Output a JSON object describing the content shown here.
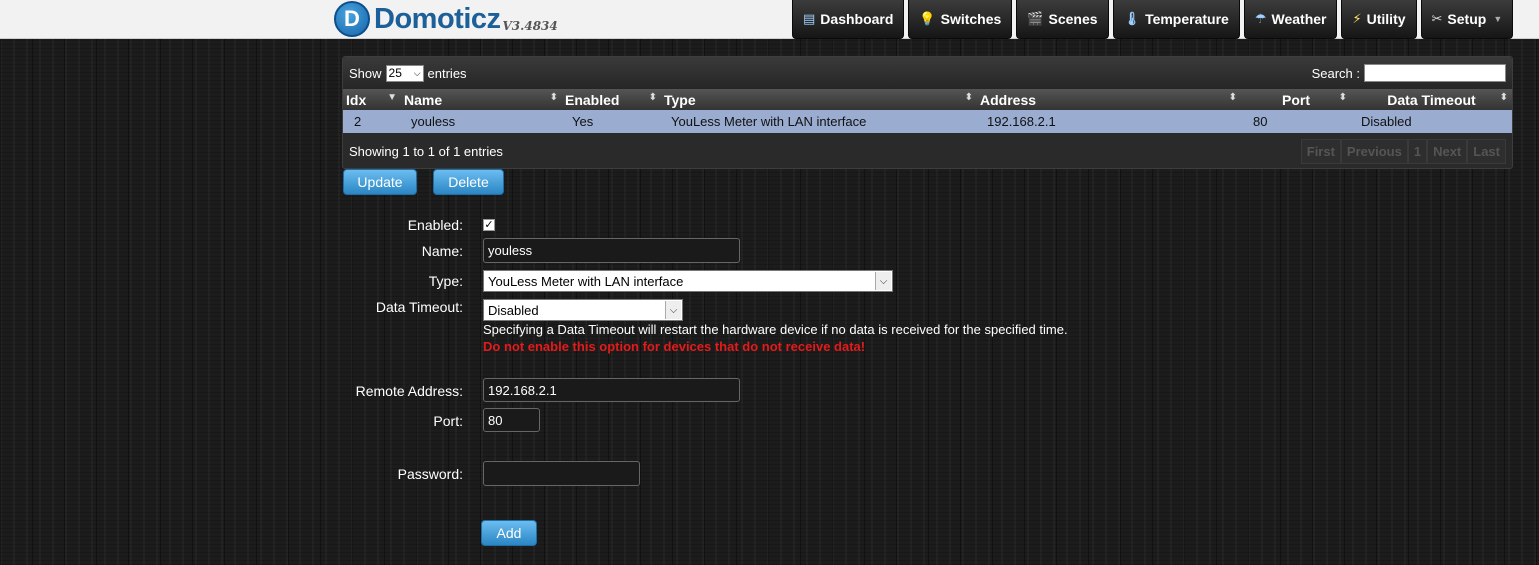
{
  "header": {
    "logo_mark": "D",
    "logo_text": "Domoticz",
    "version": "V3.4834",
    "nav": [
      {
        "label": "Dashboard",
        "icon": "dashboard-icon",
        "glyph": "▤"
      },
      {
        "label": "Switches",
        "icon": "lightbulb-icon",
        "glyph": "💡"
      },
      {
        "label": "Scenes",
        "icon": "clapperboard-icon",
        "glyph": "🎬"
      },
      {
        "label": "Temperature",
        "icon": "thermometer-icon",
        "glyph": "🌡"
      },
      {
        "label": "Weather",
        "icon": "cloud-rain-icon",
        "glyph": "☂"
      },
      {
        "label": "Utility",
        "icon": "lightning-icon",
        "glyph": "⚡"
      },
      {
        "label": "Setup",
        "icon": "tools-icon",
        "glyph": "✂"
      }
    ]
  },
  "table": {
    "show_label": "Show",
    "entries_value": "25",
    "entries_label": "entries",
    "search_label": "Search :",
    "search_value": "",
    "columns": [
      "Idx",
      "Name",
      "Enabled",
      "Type",
      "Address",
      "Port",
      "Data Timeout"
    ],
    "rows": [
      {
        "idx": "2",
        "name": "youless",
        "enabled": "Yes",
        "type": "YouLess Meter with LAN interface",
        "address": "192.168.2.1",
        "port": "80",
        "timeout": "Disabled"
      }
    ],
    "info": "Showing 1 to 1 of 1 entries",
    "paging": [
      "First",
      "Previous",
      "1",
      "Next",
      "Last"
    ]
  },
  "actions": {
    "update": "Update",
    "delete": "Delete"
  },
  "form": {
    "enabled_label": "Enabled:",
    "enabled_checked": true,
    "name_label": "Name:",
    "name_value": "youless",
    "type_label": "Type:",
    "type_value": "YouLess Meter with LAN interface",
    "timeout_label": "Data Timeout:",
    "timeout_value": "Disabled",
    "timeout_note": "Specifying a Data Timeout will restart the hardware device if no data is received for the specified time.",
    "timeout_warning": "Do not enable this option for devices that do not receive data!",
    "address_label": "Remote Address:",
    "address_value": "192.168.2.1",
    "port_label": "Port:",
    "port_value": "80",
    "password_label": "Password:",
    "password_value": "",
    "add_label": "Add"
  },
  "colors": {
    "accent": "#2b86c4",
    "row_selected": "#9aacd0",
    "warning": "#e51a1a"
  }
}
